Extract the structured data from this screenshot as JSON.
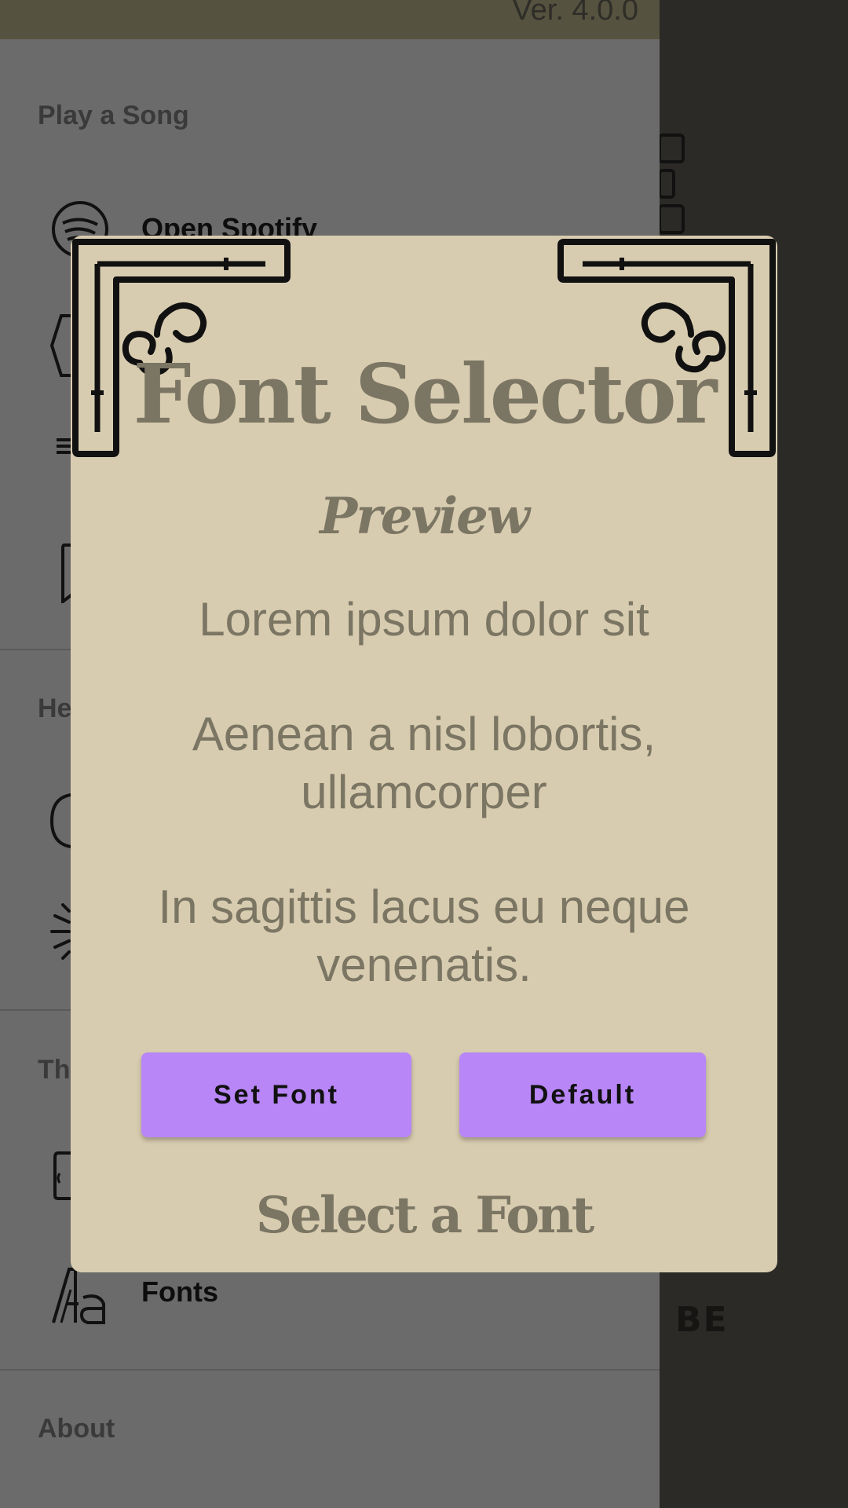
{
  "drawer": {
    "version": "Ver. 4.0.0",
    "sections": {
      "play_a_song": "Play a Song",
      "help_partial": "He",
      "theme_partial": "Th",
      "about": "About"
    },
    "items": {
      "open_spotify": "Open Spotify",
      "fonts": "Fonts"
    }
  },
  "background": {
    "partial_text": "BE"
  },
  "dialog": {
    "title": "Font Selector",
    "preview_heading": "Preview",
    "preview_lines": [
      "Lorem ipsum dolor sit",
      "Aenean a nisl lobortis, ullamcorper",
      "In sagittis lacus eu neque venenatis."
    ],
    "set_font_label": "Set Font",
    "default_label": "Default",
    "select_heading": "Select a Font"
  },
  "colors": {
    "dialog_bg": "#d8ccb0",
    "dialog_text": "#7b7563",
    "button_accent": "#b886f7",
    "drawer_bg": "#6b6b6b"
  }
}
